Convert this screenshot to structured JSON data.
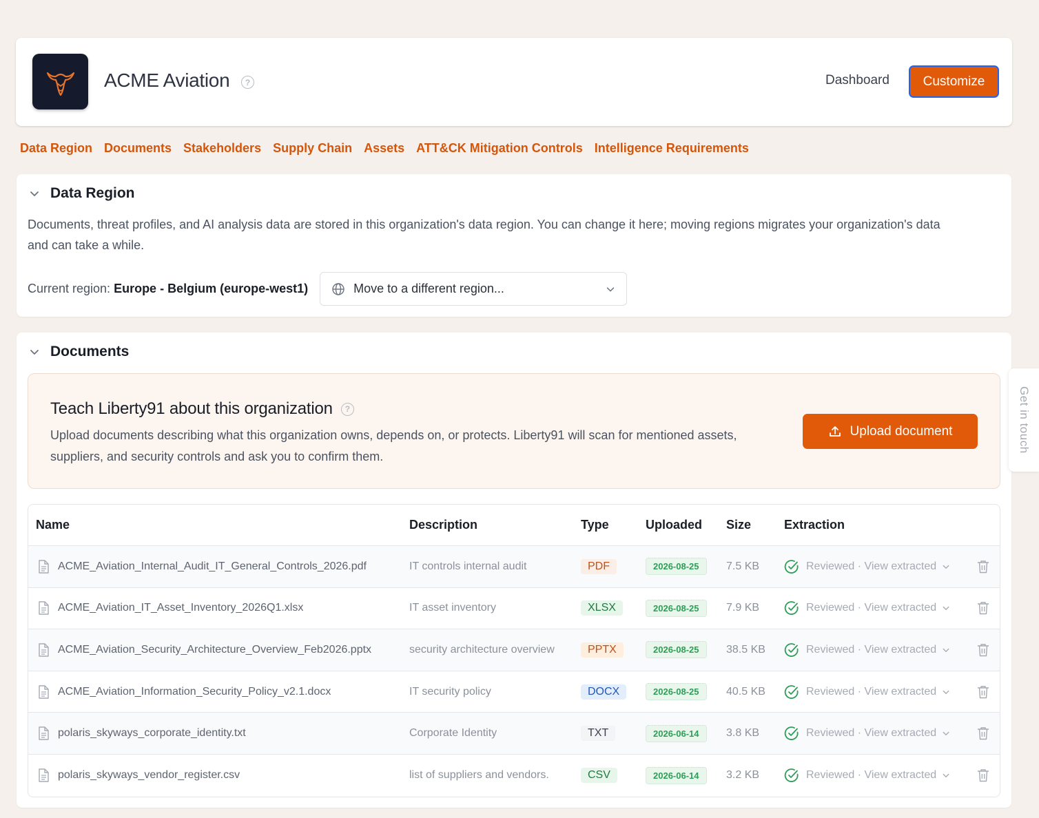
{
  "header": {
    "org_name": "ACME Aviation",
    "dashboard_label": "Dashboard",
    "customize_label": "Customize"
  },
  "tabs": [
    {
      "label": "Data Region"
    },
    {
      "label": "Documents"
    },
    {
      "label": "Stakeholders"
    },
    {
      "label": "Supply Chain"
    },
    {
      "label": "Assets"
    },
    {
      "label": "ATT&CK Mitigation Controls"
    },
    {
      "label": "Intelligence Requirements"
    }
  ],
  "data_region": {
    "title": "Data Region",
    "description": "Documents, threat profiles, and AI analysis data are stored in this organization's data region. You can change it here; moving regions migrates your organization's data and can take a while.",
    "current_label": "Current region:",
    "current_value": "Europe - Belgium (europe-west1)",
    "select_placeholder": "Move to a different region..."
  },
  "documents": {
    "title": "Documents",
    "teach_title": "Teach Liberty91 about this organization",
    "teach_desc": "Upload documents describing what this organization owns, depends on, or protects. Liberty91 will scan for mentioned assets, suppliers, and security controls and ask you to confirm them.",
    "upload_label": "Upload document",
    "columns": [
      "Name",
      "Description",
      "Type",
      "Uploaded",
      "Size",
      "Extraction"
    ],
    "rows": [
      {
        "name": "ACME_Aviation_Internal_Audit_IT_General_Controls_2026.pdf",
        "description": "IT controls internal audit",
        "type": "PDF",
        "uploaded": "2026-08-25",
        "size": "7.5 KB",
        "extraction": "Reviewed · View extracted"
      },
      {
        "name": "ACME_Aviation_IT_Asset_Inventory_2026Q1.xlsx",
        "description": "IT asset inventory",
        "type": "XLSX",
        "uploaded": "2026-08-25",
        "size": "7.9 KB",
        "extraction": "Reviewed · View extracted"
      },
      {
        "name": "ACME_Aviation_Security_Architecture_Overview_Feb2026.pptx",
        "description": "security architecture overview",
        "type": "PPTX",
        "uploaded": "2026-08-25",
        "size": "38.5 KB",
        "extraction": "Reviewed · View extracted"
      },
      {
        "name": "ACME_Aviation_Information_Security_Policy_v2.1.docx",
        "description": "IT security policy",
        "type": "DOCX",
        "uploaded": "2026-08-25",
        "size": "40.5 KB",
        "extraction": "Reviewed · View extracted"
      },
      {
        "name": "polaris_skyways_corporate_identity.txt",
        "description": "Corporate Identity",
        "type": "TXT",
        "uploaded": "2026-06-14",
        "size": "3.8 KB",
        "extraction": "Reviewed · View extracted"
      },
      {
        "name": "polaris_skyways_vendor_register.csv",
        "description": "list of suppliers and vendors.",
        "type": "CSV",
        "uploaded": "2026-06-14",
        "size": "3.2 KB",
        "extraction": "Reviewed · View extracted"
      }
    ]
  },
  "type_colors": {
    "PDF": {
      "bg": "#fbeee6",
      "fg": "#c0501a"
    },
    "XLSX": {
      "bg": "#e6f6ea",
      "fg": "#1f7a3d"
    },
    "PPTX": {
      "bg": "#fdeedd",
      "fg": "#c0501a"
    },
    "DOCX": {
      "bg": "#e3eefc",
      "fg": "#2557b0"
    },
    "TXT": {
      "bg": "#f3f4f6",
      "fg": "#3b414d"
    },
    "CSV": {
      "bg": "#e6f6ea",
      "fg": "#1f7a3d"
    }
  },
  "colors": {
    "accent": "#e15a0a",
    "tab": "#d4560b",
    "success": "#2e9d57"
  },
  "side_tab": "Get in touch"
}
